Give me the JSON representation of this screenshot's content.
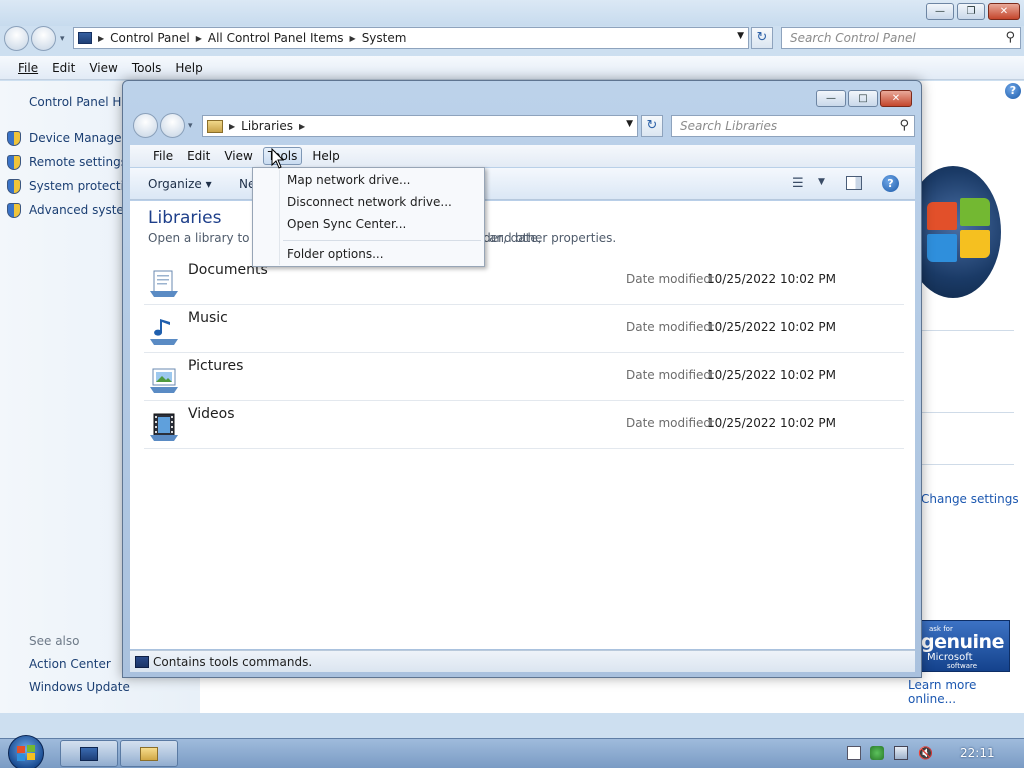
{
  "bg_window": {
    "breadcrumbs": [
      "Control Panel",
      "All Control Panel Items",
      "System"
    ],
    "search_placeholder": "Search Control Panel",
    "menu": [
      "File",
      "Edit",
      "View",
      "Tools",
      "Help"
    ],
    "left_nav": {
      "home": "Control Panel Home",
      "links": [
        "Device Manager",
        "Remote settings",
        "System protection",
        "Advanced system settings"
      ],
      "see_also_heading": "See also",
      "see_also": [
        "Action Center",
        "Windows Update"
      ]
    },
    "change_settings": "Change settings",
    "genuine_badge": {
      "line1": "ask for",
      "line2": "genuine",
      "line3": "Microsoft",
      "line4": "software"
    },
    "learn_more": "Learn more online..."
  },
  "lib_window": {
    "breadcrumbs": [
      "Libraries"
    ],
    "search_placeholder": "Search Libraries",
    "menu": [
      "File",
      "Edit",
      "View",
      "Tools",
      "Help"
    ],
    "active_menu": "Tools",
    "cmd": {
      "organize": "Organize",
      "new_library": "New library"
    },
    "title": "Libraries",
    "subtitle_left": "Open a library to see your files and arrange them by folder, date,",
    "subtitle_right": "and other properties.",
    "date_label": "Date modified:",
    "items": [
      {
        "name": "Documents",
        "date": "10/25/2022 10:02 PM",
        "icon": "documents-library-icon"
      },
      {
        "name": "Music",
        "date": "10/25/2022 10:02 PM",
        "icon": "music-library-icon"
      },
      {
        "name": "Pictures",
        "date": "10/25/2022 10:02 PM",
        "icon": "pictures-library-icon"
      },
      {
        "name": "Videos",
        "date": "10/25/2022 10:02 PM",
        "icon": "videos-library-icon"
      }
    ],
    "status": "Contains tools commands."
  },
  "tools_menu": {
    "items": [
      "Map network drive...",
      "Disconnect network drive...",
      "Open Sync Center...",
      "Folder options..."
    ]
  },
  "taskbar": {
    "clock": "22:11"
  }
}
